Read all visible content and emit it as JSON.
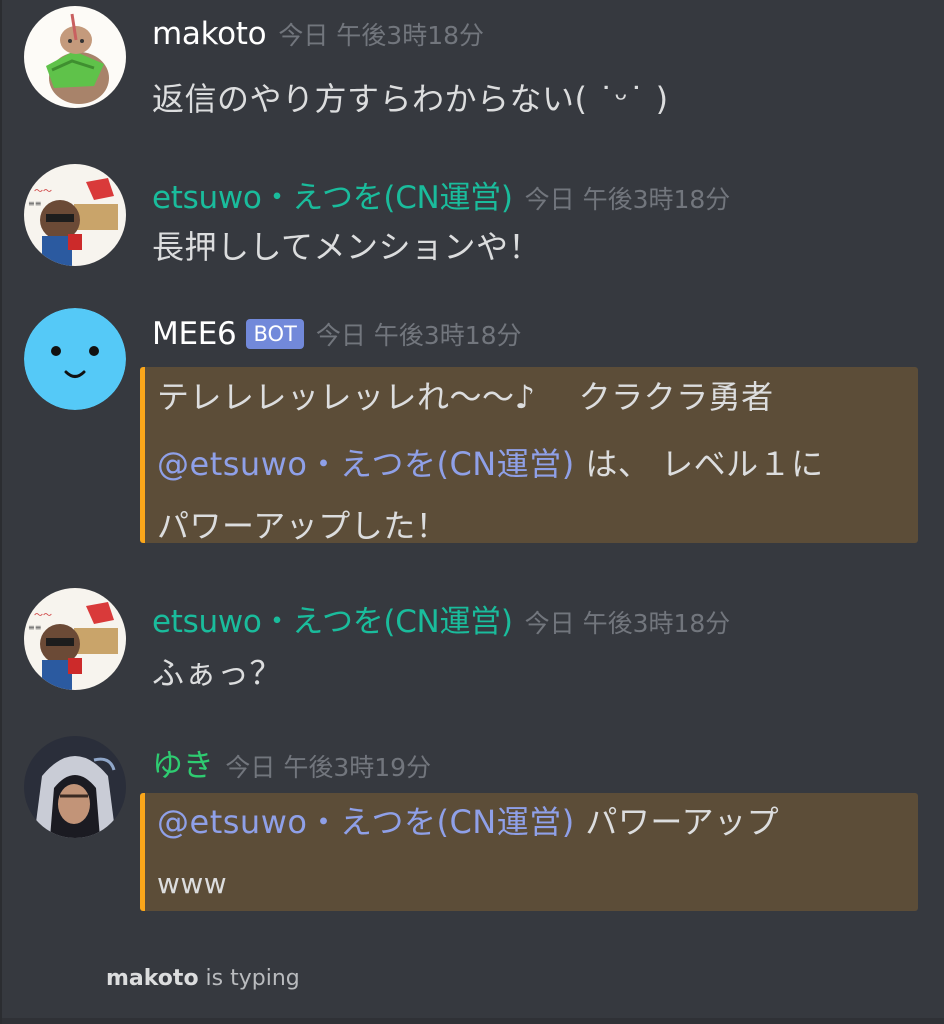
{
  "messages": [
    {
      "author": "makoto",
      "author_color": "#ffffff",
      "timestamp": "今日 午後3時18分",
      "text": "返信のやり方すらわからない( ˙ᵕ˙ )"
    },
    {
      "author": "etsuwo・えつを(CN運営)",
      "author_color": "#1abc9c",
      "timestamp": "今日 午後3時18分",
      "text": "長押ししてメンションや！"
    },
    {
      "author": "MEE6",
      "author_color": "#ffffff",
      "badge": "BOT",
      "timestamp": "今日 午後3時18分",
      "line1": "テレレレッレッレれ〜〜♪　 クラクラ勇者",
      "mention": "@etsuwo・えつを(CN運営)",
      "line2_rest": " は、 レベル１に",
      "line3": "パワーアップした！"
    },
    {
      "author": "etsuwo・えつを(CN運営)",
      "author_color": "#1abc9c",
      "timestamp": "今日 午後3時18分",
      "text": "ふぁっ？"
    },
    {
      "author": "ゆき",
      "author_color": "#2ecc71",
      "timestamp": "今日 午後3時19分",
      "mention": "@etsuwo・えつを(CN運営)",
      "line1_rest": " パワーアップ",
      "line2": "www"
    }
  ],
  "typing": {
    "user": "makoto",
    "suffix": " is typing"
  },
  "colors": {
    "background": "#36393f",
    "mention_highlight": "#5c4d38",
    "mention_border": "#faa61a",
    "mention_text": "#8fa0e8",
    "bot_badge": "#7289da"
  }
}
